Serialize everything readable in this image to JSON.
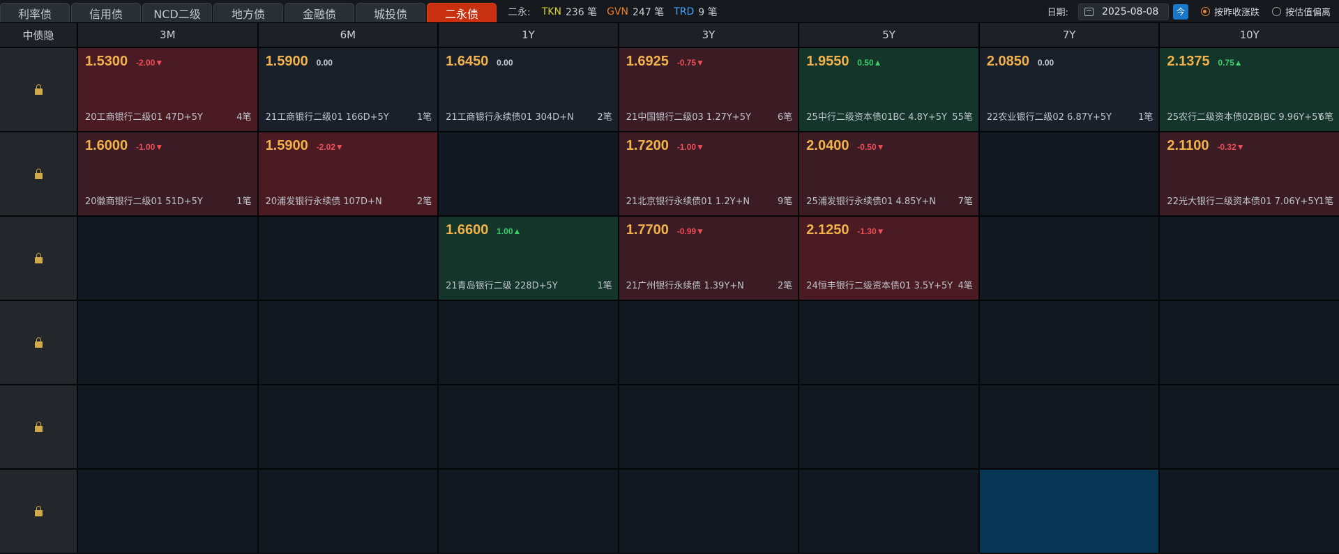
{
  "tabs": [
    {
      "label": "利率债",
      "active": false
    },
    {
      "label": "信用债",
      "active": false
    },
    {
      "label": "NCD二级",
      "active": false
    },
    {
      "label": "地方债",
      "active": false
    },
    {
      "label": "金融债",
      "active": false
    },
    {
      "label": "城投债",
      "active": false
    },
    {
      "label": "二永债",
      "active": true
    }
  ],
  "stats": {
    "label": "二永:",
    "tkn_label": "TKN",
    "tkn_count": "236 笔",
    "gvn_label": "GVN",
    "gvn_count": "247 笔",
    "trd_label": "TRD",
    "trd_count": "9 笔"
  },
  "controls": {
    "date_label": "日期:",
    "date_value": "2025-08-08",
    "today_label": "今",
    "radio1_label": "按昨收涨跌",
    "radio2_label": "按估值偏离"
  },
  "grid": {
    "corner_label": "中债隐",
    "columns": [
      "3M",
      "6M",
      "1Y",
      "3Y",
      "5Y",
      "7Y",
      "10Y"
    ],
    "cells": [
      [
        {
          "price": "1.5300",
          "change": "-2.00▼",
          "dir": "dn",
          "bond": "20工商银行二级01 47D+5Y",
          "count": "4笔",
          "style": "red"
        },
        {
          "price": "1.5900",
          "change": "0.00",
          "dir": "flat",
          "bond": "21工商银行二级01 166D+5Y",
          "count": "1笔",
          "style": "neutral"
        },
        {
          "price": "1.6450",
          "change": "0.00",
          "dir": "flat",
          "bond": "21工商银行永续债01 304D+N",
          "count": "2笔",
          "style": "neutral"
        },
        {
          "price": "1.6925",
          "change": "-0.75▼",
          "dir": "dn",
          "bond": "21中国银行二级03 1.27Y+5Y",
          "count": "6笔",
          "style": "red2"
        },
        {
          "price": "1.9550",
          "change": "0.50▲",
          "dir": "up",
          "bond": "25中行二级资本债01BC 4.8Y+5Y",
          "count": "55笔",
          "style": "green"
        },
        {
          "price": "2.0850",
          "change": "0.00",
          "dir": "flat",
          "bond": "22农业银行二级02 6.87Y+5Y",
          "count": "1笔",
          "style": "neutral"
        },
        {
          "price": "2.1375",
          "change": "0.75▲",
          "dir": "up",
          "bond": "25农行二级资本债02B(BC 9.96Y+5Y",
          "count": "6笔",
          "style": "green"
        }
      ],
      [
        {
          "price": "1.6000",
          "change": "-1.00▼",
          "dir": "dn",
          "bond": "20徽商银行二级01 51D+5Y",
          "count": "1笔",
          "style": "red2"
        },
        {
          "price": "1.5900",
          "change": "-2.02▼",
          "dir": "dn",
          "bond": "20浦发银行永续债 107D+N",
          "count": "2笔",
          "style": "red"
        },
        {
          "price": "",
          "change": "",
          "dir": "",
          "bond": "",
          "count": "",
          "style": "empty"
        },
        {
          "price": "1.7200",
          "change": "-1.00▼",
          "dir": "dn",
          "bond": "21北京银行永续债01 1.2Y+N",
          "count": "9笔",
          "style": "red2"
        },
        {
          "price": "2.0400",
          "change": "-0.50▼",
          "dir": "dn",
          "bond": "25浦发银行永续债01 4.85Y+N",
          "count": "7笔",
          "style": "red2"
        },
        {
          "price": "",
          "change": "",
          "dir": "",
          "bond": "",
          "count": "",
          "style": "empty"
        },
        {
          "price": "2.1100",
          "change": "-0.32▼",
          "dir": "dn",
          "bond": "22光大银行二级资本债01 7.06Y+5Y",
          "count": "1笔",
          "style": "red2"
        }
      ],
      [
        {
          "price": "",
          "change": "",
          "dir": "",
          "bond": "",
          "count": "",
          "style": "empty"
        },
        {
          "price": "",
          "change": "",
          "dir": "",
          "bond": "",
          "count": "",
          "style": "empty"
        },
        {
          "price": "1.6600",
          "change": "1.00▲",
          "dir": "up",
          "bond": "21青岛银行二级 228D+5Y",
          "count": "1笔",
          "style": "green"
        },
        {
          "price": "1.7700",
          "change": "-0.99▼",
          "dir": "dn",
          "bond": "21广州银行永续债 1.39Y+N",
          "count": "2笔",
          "style": "red2"
        },
        {
          "price": "2.1250",
          "change": "-1.30▼",
          "dir": "dn",
          "bond": "24恒丰银行二级资本债01 3.5Y+5Y",
          "count": "4笔",
          "style": "red"
        },
        {
          "price": "",
          "change": "",
          "dir": "",
          "bond": "",
          "count": "",
          "style": "empty"
        },
        {
          "price": "",
          "change": "",
          "dir": "",
          "bond": "",
          "count": "",
          "style": "empty"
        }
      ],
      [
        {
          "style": "empty"
        },
        {
          "style": "empty"
        },
        {
          "style": "empty"
        },
        {
          "style": "empty"
        },
        {
          "style": "empty"
        },
        {
          "style": "empty"
        },
        {
          "style": "empty"
        }
      ],
      [
        {
          "style": "empty"
        },
        {
          "style": "empty"
        },
        {
          "style": "empty"
        },
        {
          "style": "empty"
        },
        {
          "style": "empty"
        },
        {
          "style": "empty"
        },
        {
          "style": "empty"
        }
      ],
      [
        {
          "style": "empty"
        },
        {
          "style": "empty"
        },
        {
          "style": "empty"
        },
        {
          "style": "empty"
        },
        {
          "style": "empty"
        },
        {
          "style": "blue"
        },
        {
          "style": "empty"
        }
      ]
    ]
  },
  "colors": {
    "accent_tab": "#c9300f",
    "price": "#f2b24b",
    "down": "#f04e58",
    "up": "#3ccf6b",
    "lock": "#d1a94a"
  },
  "icons": {
    "row_lock": "lock-icon",
    "date_picker": "calendar-icon"
  }
}
